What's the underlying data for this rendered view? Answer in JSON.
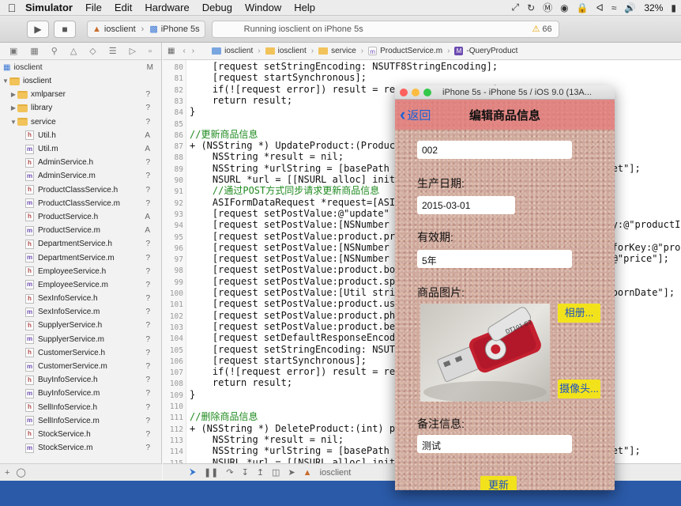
{
  "menubar": {
    "app_name": "Simulator",
    "menus": [
      "File",
      "Edit",
      "Hardware",
      "Debug",
      "Window",
      "Help"
    ],
    "battery": "32%"
  },
  "toolbar": {
    "scheme_target": "iosclient",
    "scheme_device": "iPhone 5s",
    "activity_text": "Running iosclient on iPhone 5s",
    "warning_count": "66"
  },
  "navigator": {
    "project_name": "iosclient",
    "project_badge": "M",
    "items": [
      {
        "name": "iosclient",
        "kind": "folder",
        "indent": 1,
        "badge": "",
        "open": true
      },
      {
        "name": "xmlparser",
        "kind": "folder",
        "indent": 2,
        "badge": "?",
        "open": false
      },
      {
        "name": "library",
        "kind": "folder",
        "indent": 2,
        "badge": "?",
        "open": false
      },
      {
        "name": "service",
        "kind": "folder",
        "indent": 2,
        "badge": "?",
        "open": true
      },
      {
        "name": "Util.h",
        "kind": "h",
        "indent": 3,
        "badge": "A"
      },
      {
        "name": "Util.m",
        "kind": "m",
        "indent": 3,
        "badge": "A"
      },
      {
        "name": "AdminService.h",
        "kind": "h",
        "indent": 3,
        "badge": "?"
      },
      {
        "name": "AdminService.m",
        "kind": "m",
        "indent": 3,
        "badge": "?"
      },
      {
        "name": "ProductClassService.h",
        "kind": "h",
        "indent": 3,
        "badge": "?"
      },
      {
        "name": "ProductClassService.m",
        "kind": "m",
        "indent": 3,
        "badge": "?"
      },
      {
        "name": "ProductService.h",
        "kind": "h",
        "indent": 3,
        "badge": "A"
      },
      {
        "name": "ProductService.m",
        "kind": "m",
        "indent": 3,
        "badge": "A"
      },
      {
        "name": "DepartmentService.h",
        "kind": "h",
        "indent": 3,
        "badge": "?"
      },
      {
        "name": "DepartmentService.m",
        "kind": "m",
        "indent": 3,
        "badge": "?"
      },
      {
        "name": "EmployeeService.h",
        "kind": "h",
        "indent": 3,
        "badge": "?"
      },
      {
        "name": "EmployeeService.m",
        "kind": "m",
        "indent": 3,
        "badge": "?"
      },
      {
        "name": "SexInfoService.h",
        "kind": "h",
        "indent": 3,
        "badge": "?"
      },
      {
        "name": "SexInfoService.m",
        "kind": "m",
        "indent": 3,
        "badge": "?"
      },
      {
        "name": "SupplyerService.h",
        "kind": "h",
        "indent": 3,
        "badge": "?"
      },
      {
        "name": "SupplyerService.m",
        "kind": "m",
        "indent": 3,
        "badge": "?"
      },
      {
        "name": "CustomerService.h",
        "kind": "h",
        "indent": 3,
        "badge": "?"
      },
      {
        "name": "CustomerService.m",
        "kind": "m",
        "indent": 3,
        "badge": "?"
      },
      {
        "name": "BuyInfoService.h",
        "kind": "h",
        "indent": 3,
        "badge": "?"
      },
      {
        "name": "BuyInfoService.m",
        "kind": "m",
        "indent": 3,
        "badge": "?"
      },
      {
        "name": "SellInfoService.h",
        "kind": "h",
        "indent": 3,
        "badge": "?"
      },
      {
        "name": "SellInfoService.m",
        "kind": "m",
        "indent": 3,
        "badge": "?"
      },
      {
        "name": "StockService.h",
        "kind": "h",
        "indent": 3,
        "badge": "?"
      },
      {
        "name": "StockService.m",
        "kind": "m",
        "indent": 3,
        "badge": "?"
      }
    ]
  },
  "jumpbar": {
    "crumbs": [
      "iosclient",
      "iosclient",
      "service",
      "ProductService.m",
      "-QueryProduct"
    ]
  },
  "editor": {
    "lines": [
      {
        "n": "80",
        "text": "    [request setStringEncoding: NSUTF8StringEncoding];",
        "comment": false
      },
      {
        "n": "81",
        "text": "    [request startSynchronous];",
        "comment": false
      },
      {
        "n": "82",
        "text": "    if(![request error]) result = request.responseString;",
        "comment": false
      },
      {
        "n": "83",
        "text": "    return result;",
        "comment": false
      },
      {
        "n": "84",
        "text": "}",
        "comment": false
      },
      {
        "n": "85",
        "text": "",
        "comment": false
      },
      {
        "n": "86",
        "text": "//更新商品信息",
        "comment": true
      },
      {
        "n": "87",
        "text": "+ (NSString *) UpdateProduct:(Product *)product {",
        "comment": false
      },
      {
        "n": "88",
        "text": "    NSString *result = nil;",
        "comment": false
      },
      {
        "n": "89",
        "text": "    NSString *urlString = [basePath stringByAppendingString:@\"ProductServlet\"];",
        "comment": false
      },
      {
        "n": "90",
        "text": "    NSURL *url = [[NSURL alloc] initWithString:urlString];",
        "comment": false
      },
      {
        "n": "91",
        "text": "    //通过POST方式同步请求更新商品信息",
        "comment": true
      },
      {
        "n": "92",
        "text": "    ASIFormDataRequest *request=[ASIFormDataRequest requestWithURL:url];",
        "comment": false
      },
      {
        "n": "93",
        "text": "    [request setPostValue:@\"update\" forKey:@\"action\"];",
        "comment": false
      },
      {
        "n": "94",
        "text": "    [request setPostValue:[NSNumber numberWithInt:product.productId] forKey:@\"productId\"];",
        "comment": false
      },
      {
        "n": "95",
        "text": "    [request setPostValue:product.productName forKey:@\"productName\"];",
        "comment": false
      },
      {
        "n": "96",
        "text": "    [request setPostValue:[NSNumber numberWithInt:product.productClassId] forKey:@\"productClassId\"];",
        "comment": false
      },
      {
        "n": "97",
        "text": "    [request setPostValue:[NSNumber numberWithFloat:product.price] forKey:@\"price\"];",
        "comment": false
      },
      {
        "n": "98",
        "text": "    [request setPostValue:product.bookNum forKey:@\"bookNum\"];",
        "comment": false
      },
      {
        "n": "99",
        "text": "    [request setPostValue:product.spec forKey:@\"spec\"];",
        "comment": false
      },
      {
        "n": "100",
        "text": "    [request setPostValue:[Util stringFromDate:product.bornDate] forKey:@\"bornDate\"];",
        "comment": false
      },
      {
        "n": "101",
        "text": "    [request setPostValue:product.useDate forKey:@\"useDate\"];",
        "comment": false
      },
      {
        "n": "102",
        "text": "    [request setPostValue:product.photo forKey:@\"photo\"];",
        "comment": false
      },
      {
        "n": "103",
        "text": "    [request setPostValue:product.beizhu forKey:@\"beizhu\"];",
        "comment": false
      },
      {
        "n": "104",
        "text": "    [request setDefaultResponseEncoding:NSUTF8StringEncoding];",
        "comment": false
      },
      {
        "n": "105",
        "text": "    [request setStringEncoding: NSUTF8StringEncoding];",
        "comment": false
      },
      {
        "n": "106",
        "text": "    [request startSynchronous];",
        "comment": false
      },
      {
        "n": "107",
        "text": "    if(![request error]) result = request.responseString;",
        "comment": false
      },
      {
        "n": "108",
        "text": "    return result;",
        "comment": false
      },
      {
        "n": "109",
        "text": "}",
        "comment": false
      },
      {
        "n": "110",
        "text": "",
        "comment": false
      },
      {
        "n": "111",
        "text": "//删除商品信息",
        "comment": true
      },
      {
        "n": "112",
        "text": "+ (NSString *) DeleteProduct:(int) productId {",
        "comment": false
      },
      {
        "n": "113",
        "text": "    NSString *result = nil;",
        "comment": false
      },
      {
        "n": "114",
        "text": "    NSString *urlString = [basePath stringByAppendingString:@\"ProductServlet\"];",
        "comment": false
      },
      {
        "n": "115",
        "text": "    NSURL *url = [[NSURL alloc] initWithString:urlString];",
        "comment": false
      }
    ]
  },
  "debugbar": {
    "target": "iosclient"
  },
  "simulator": {
    "window_title": "iPhone 5s - iPhone 5s / iOS 9.0 (13A...",
    "nav": {
      "back_label": "返回",
      "title": "编辑商品信息"
    },
    "form": {
      "spec_value": "002",
      "born_date_label": "生产日期:",
      "born_date_value": "2015-03-01",
      "use_date_label": "有效期:",
      "use_date_value": "5年",
      "photo_label": "商品图片:",
      "album_button": "相册...",
      "camera_button": "摄像头...",
      "remark_label": "备注信息:",
      "remark_value": "测试",
      "submit_button": "更新"
    }
  }
}
